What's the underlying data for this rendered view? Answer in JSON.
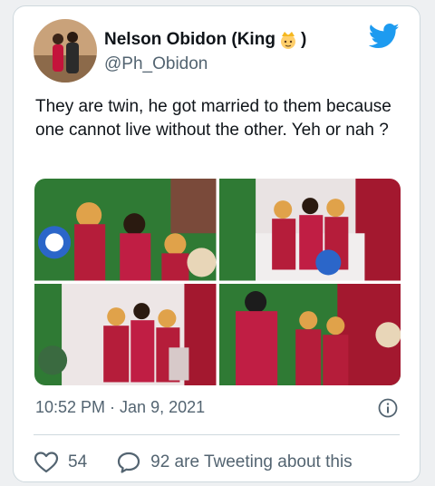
{
  "author": {
    "name": "Nelson Obidon (King",
    "name_suffix": ")",
    "handle": "@Ph_Obidon"
  },
  "tweet": {
    "text": "They are twin, he got married to them because one cannot live without the other. Yeh or nah ?",
    "timestamp": "10:52 PM · Jan 9, 2021"
  },
  "actions": {
    "likes": "54",
    "replies_label": "92 are Tweeting about this"
  },
  "icons": [
    "crown-emoji-icon",
    "twitter-bird-icon",
    "info-icon",
    "heart-icon",
    "comment-icon"
  ],
  "colors": {
    "twitter_blue": "#1d9bf0",
    "text_primary": "#0f1419",
    "text_secondary": "#536471",
    "border": "#cfd9de"
  }
}
